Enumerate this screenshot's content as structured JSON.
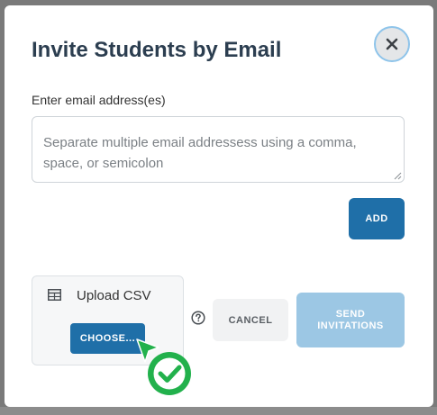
{
  "modal": {
    "title": "Invite Students by Email",
    "close_icon": "close-icon"
  },
  "email_field": {
    "label": "Enter email address(es)",
    "value": "",
    "placeholder": "Separate multiple email addressess using a comma, space, or semicolon"
  },
  "add_button": {
    "label": "ADD"
  },
  "upload": {
    "icon": "table-icon",
    "label": "Upload CSV",
    "choose_label": "CHOOSE..."
  },
  "help_icon": "question-circle-icon",
  "footer": {
    "cancel_label": "CANCEL",
    "send_label_line1": "SEND",
    "send_label_line2": "INVITATIONS",
    "send_disabled": true
  },
  "pointer": {
    "icon": "check-circle-cursor-icon"
  },
  "colors": {
    "primary": "#1f6fa8",
    "primary_disabled": "#9cc7e4",
    "title_text": "#2c3e50",
    "close_ring": "#8ec4ea",
    "pointer_green": "#22b14c"
  }
}
